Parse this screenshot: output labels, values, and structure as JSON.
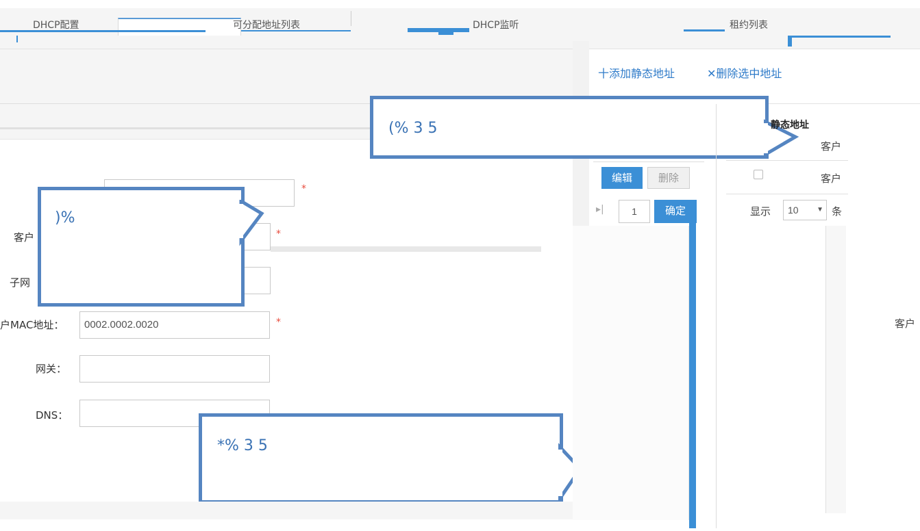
{
  "tabs": [
    {
      "label": "DHCP配置",
      "active": false
    },
    {
      "label": "",
      "active": true
    },
    {
      "label": "可分配地址列表",
      "active": false
    },
    {
      "label": "DHCP监听",
      "active": false
    },
    {
      "label": "租约列表",
      "active": false
    }
  ],
  "toolbar": {
    "add_static_label": "十添加静态地址",
    "delete_selected_label": "✕删除选中地址"
  },
  "callouts": [
    {
      "text": "(%                                       3          5"
    },
    {
      "text": ")%"
    },
    {
      "text": "*%       3                   5"
    }
  ],
  "form": {
    "client_label": "客户",
    "subnet_label": "子网",
    "mac_label": "户MAC地址：",
    "mac_value": "0002.0002.0020",
    "gateway_label": "网关：",
    "dns_label": "DNS：",
    "required_mark": "*"
  },
  "right_panel": {
    "title": "静态地址",
    "col_client": "客户",
    "row_client": "客户",
    "edit_label": "编辑",
    "delete_label": "删除",
    "page_value": "1",
    "confirm_label": "确定",
    "show_label": "显示",
    "page_size": "10",
    "per_label": "条",
    "far_right_label": "客户"
  },
  "colors": {
    "accent": "#3b8fd6",
    "callout_border": "#5585c1",
    "required": "#e84c3d"
  }
}
